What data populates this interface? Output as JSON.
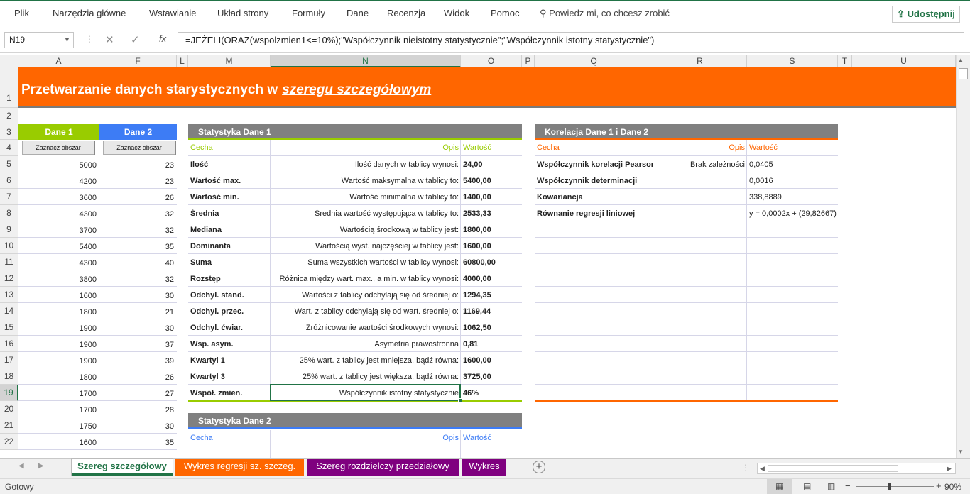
{
  "menu": {
    "items": [
      "Plik",
      "Narzędzia główne",
      "Wstawianie",
      "Układ strony",
      "Formuły",
      "Dane",
      "Recenzja",
      "Widok",
      "Pomoc"
    ],
    "tell_me": "Powiedz mi, co chcesz zrobić",
    "share": "Udostępnij"
  },
  "formula_bar": {
    "name_box": "N19",
    "fx": "fx",
    "formula": "=JEŻELI(ORAZ(wspolzmien1<=10%);\"Współczynnik nieistotny statystycznie\";\"Współczynnik istotny statystycznie\")"
  },
  "columns": [
    "A",
    "F",
    "L",
    "M",
    "N",
    "O",
    "P",
    "Q",
    "R",
    "S",
    "T",
    "U"
  ],
  "rows": [
    "1",
    "2",
    "3",
    "4",
    "5",
    "6",
    "7",
    "8",
    "9",
    "10",
    "11",
    "12",
    "13",
    "14",
    "15",
    "16",
    "17",
    "18",
    "19",
    "20",
    "21",
    "22"
  ],
  "title": {
    "main": "Przetwarzanie danych starystycznych w",
    "em": "szeregu szczegółowym"
  },
  "dane": {
    "header1": "Dane 1",
    "header2": "Dane 2",
    "button_label": "Zaznacz obszar",
    "values1": [
      "5000",
      "4200",
      "3600",
      "4300",
      "3700",
      "5400",
      "4300",
      "3800",
      "1600",
      "1800",
      "1900",
      "1900",
      "1900",
      "1800",
      "1700",
      "1700",
      "1750",
      "1600"
    ],
    "values2": [
      "23",
      "23",
      "26",
      "32",
      "32",
      "35",
      "40",
      "32",
      "30",
      "21",
      "30",
      "37",
      "39",
      "26",
      "27",
      "28",
      "30",
      "35"
    ]
  },
  "stat1": {
    "title": "Statystyka Dane 1",
    "col_cecha": "Cecha",
    "col_opis": "Opis",
    "col_wartosc": "Wartość",
    "rows": [
      {
        "cecha": "Ilość",
        "opis": "Ilość danych w tablicy wynosi:",
        "wartosc": "24,00"
      },
      {
        "cecha": "Wartość max.",
        "opis": "Wartość maksymalna w tablicy to:",
        "wartosc": "5400,00"
      },
      {
        "cecha": "Wartość min.",
        "opis": "Wartość minimalna w tablicy to:",
        "wartosc": "1400,00"
      },
      {
        "cecha": "Średnia",
        "opis": "Średnia wartość występująca w tablicy to:",
        "wartosc": "2533,33"
      },
      {
        "cecha": "Mediana",
        "opis": "Wartością środkową w tablicy jest:",
        "wartosc": "1800,00"
      },
      {
        "cecha": "Dominanta",
        "opis": "Wartością wyst. najczęściej w tablicy jest:",
        "wartosc": "1600,00"
      },
      {
        "cecha": "Suma",
        "opis": "Suma wszystkich wartości w tablicy wynosi:",
        "wartosc": "60800,00"
      },
      {
        "cecha": "Rozstęp",
        "opis": "Różnica między wart. max., a min. w tablicy wynosi:",
        "wartosc": "4000,00"
      },
      {
        "cecha": "Odchyl. stand.",
        "opis": "Wartości z tablicy odchylają się od średniej o:",
        "wartosc": "1294,35"
      },
      {
        "cecha": "Odchyl. przec.",
        "opis": "Wart. z tablicy odchylają się od wart. średniej o:",
        "wartosc": "1169,44"
      },
      {
        "cecha": "Odchyl. ćwiar.",
        "opis": "Zróżnicowanie wartości środkowych wynosi:",
        "wartosc": "1062,50"
      },
      {
        "cecha": "Wsp. asym.",
        "opis": "Asymetria prawostronna",
        "wartosc": "0,81"
      },
      {
        "cecha": "Kwartyl 1",
        "opis": "25% wart. z tablicy jest mniejsza, bądź równa:",
        "wartosc": "1600,00"
      },
      {
        "cecha": "Kwartyl 3",
        "opis": "25% wart. z tablicy jest większa, bądź równa:",
        "wartosc": "3725,00"
      },
      {
        "cecha": "Współ. zmien.",
        "opis": "Współczynnik istotny statystycznie",
        "wartosc": "46%"
      }
    ]
  },
  "stat2": {
    "title": "Statystyka Dane 2",
    "col_cecha": "Cecha",
    "col_opis": "Opis",
    "col_wartosc": "Wartość"
  },
  "korelacja": {
    "title": "Korelacja Dane 1 i Dane 2",
    "col_cecha": "Cecha",
    "col_opis": "Opis",
    "col_wartosc": "Wartość",
    "rows": [
      {
        "cecha": "Współczynnik korelacji Pearsona",
        "opis": "Brak zależności",
        "wartosc": "0,0405"
      },
      {
        "cecha": "Współczynnik determinacji",
        "opis": "",
        "wartosc": "0,0016"
      },
      {
        "cecha": "Kowariancja",
        "opis": "",
        "wartosc": "338,8889"
      },
      {
        "cecha": "Równanie regresji liniowej",
        "opis": "",
        "wartosc": "y = 0,0002x + (29,82667)"
      }
    ]
  },
  "tabs": [
    {
      "label": "Szereg szczegółowy",
      "color": "#ffffff",
      "text": "#217346",
      "active": true
    },
    {
      "label": "Wykres regresji sz. szczeg.",
      "color": "#ff6600",
      "text": "#ffffff",
      "active": false
    },
    {
      "label": "Szereg rozdzielczy przedziałowy",
      "color": "#7f007f",
      "text": "#ffffff",
      "active": false
    },
    {
      "label": "Wykres",
      "color": "#7f007f",
      "text": "#ffffff",
      "active": false
    }
  ],
  "status": {
    "label": "Gotowy",
    "zoom": "90%"
  },
  "colors": {
    "accent": "#217346",
    "orange": "#ff6600",
    "green": "#99cc00",
    "blue": "#3d7cf5",
    "gray": "#808080"
  }
}
